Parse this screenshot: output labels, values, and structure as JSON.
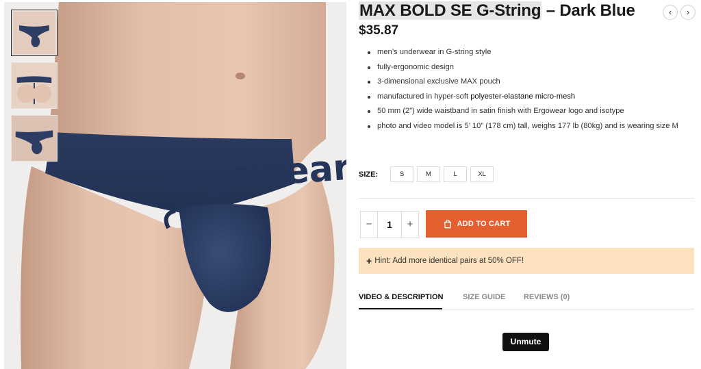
{
  "product": {
    "title_highlight": "MAX BOLD SE G-String",
    "title_rest": " – Dark Blue",
    "price": "$35.87",
    "nav": {
      "prev": "‹",
      "next": "›"
    }
  },
  "features": [
    {
      "text": "men’s underwear in G-string style"
    },
    {
      "text": "fully-ergonomic design"
    },
    {
      "text": "3-dimensional exclusive MAX pouch"
    },
    {
      "text": "manufactured in hyper-soft ",
      "strong": "polyester-elastane micro-mesh"
    },
    {
      "text": "50 mm (2”) wide waistband in satin finish with Ergowear logo and isotype"
    },
    {
      "text": "photo and video  model is 5’ 10” (178 cm) tall, weighs 177 lb (80kg) and is wearing size M"
    }
  ],
  "size": {
    "label": "SIZE:",
    "options": [
      "S",
      "M",
      "L",
      "XL"
    ]
  },
  "quantity": {
    "minus": "−",
    "value": "1",
    "plus": "+"
  },
  "cart": {
    "label": "ADD TO CART",
    "color": "#e35f2f"
  },
  "hint": {
    "plus": "+",
    "text": "Hint: Add more identical pairs at 50% OFF!",
    "bg": "#fbe1bd"
  },
  "tabs": [
    {
      "label": "VIDEO & DESCRIPTION"
    },
    {
      "label": "SIZE GUIDE"
    },
    {
      "label": "REVIEWS (0)"
    }
  ],
  "video": {
    "unmute_label": "Unmute"
  },
  "gallery": {
    "waistband_text": "ergowear",
    "garment_color": "#2d3d63"
  }
}
